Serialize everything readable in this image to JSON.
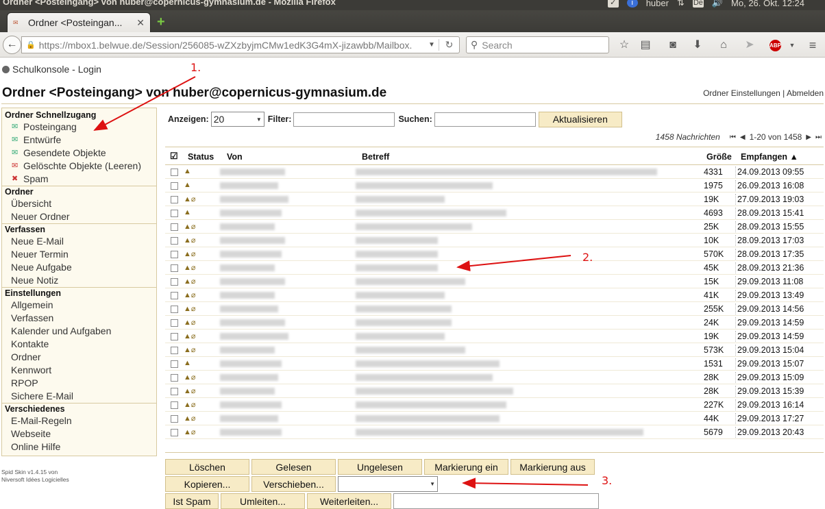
{
  "os_panel": {
    "window_title": "Ordner <Posteingang> von huber@copernicus-gymnasium.de - Mozilla Firefox",
    "user": "huber",
    "datetime": "Mo, 26. Okt. 12:24",
    "keyboard": "De"
  },
  "browser": {
    "tab_title": "Ordner <Posteingan...",
    "url": "https://mbox1.belwue.de/Session/256085-wZXzbyjmCMw1edK3G4mX-jizawbb/Mailbox.",
    "search_placeholder": "Search",
    "abp": "ABP"
  },
  "page": {
    "schulkonsole": "Schulkonsole - Login",
    "title": "Ordner <Posteingang> von huber@copernicus-gymnasium.de",
    "top_links": "Ordner Einstellungen | Abmelden",
    "skin_info_1": "Spid Skin v1.4.15 von",
    "skin_info_2": "Niversoft Idées Logicielles"
  },
  "sidebar": {
    "sections": [
      {
        "heading": "Ordner Schnellzugang",
        "items": [
          "Posteingang",
          "Entwürfe",
          "Gesendete Objekte",
          "Gelöschte Objekte  (Leeren)",
          "Spam"
        ]
      },
      {
        "heading": "Ordner",
        "items": [
          "Übersicht",
          "Neuer Ordner"
        ]
      },
      {
        "heading": "Verfassen",
        "items": [
          "Neue E-Mail",
          "Neuer Termin",
          "Neue Aufgabe",
          "Neue Notiz"
        ]
      },
      {
        "heading": "Einstellungen",
        "items": [
          "Allgemein",
          "Verfassen",
          "Kalender und Aufgaben",
          "Kontakte",
          "Ordner",
          "Kennwort",
          "RPOP",
          "Sichere E-Mail"
        ]
      },
      {
        "heading": "Verschiedenes",
        "items": [
          "E-Mail-Regeln",
          "Webseite",
          "Online Hilfe"
        ]
      }
    ]
  },
  "toolbar": {
    "show_label": "Anzeigen:",
    "show_value": "20",
    "filter_label": "Filter:",
    "search_label": "Suchen:",
    "refresh_button": "Aktualisieren"
  },
  "pager": {
    "count": "1458 Nachrichten",
    "range": "1-20 von 1458"
  },
  "table": {
    "headers": {
      "status": "Status",
      "from": "Von",
      "subject": "Betreff",
      "size": "Größe",
      "received": "Empfangen"
    },
    "rows": [
      {
        "attach": false,
        "size": "4331",
        "date": "24.09.2013 09:55"
      },
      {
        "attach": false,
        "size": "1975",
        "date": "26.09.2013 16:08"
      },
      {
        "attach": true,
        "size": "19K",
        "date": "27.09.2013 19:03"
      },
      {
        "attach": false,
        "size": "4693",
        "date": "28.09.2013 15:41"
      },
      {
        "attach": true,
        "size": "25K",
        "date": "28.09.2013 15:55"
      },
      {
        "attach": true,
        "size": "10K",
        "date": "28.09.2013 17:03"
      },
      {
        "attach": true,
        "size": "570K",
        "date": "28.09.2013 17:35"
      },
      {
        "attach": true,
        "size": "45K",
        "date": "28.09.2013 21:36"
      },
      {
        "attach": true,
        "size": "15K",
        "date": "29.09.2013 11:08"
      },
      {
        "attach": true,
        "size": "41K",
        "date": "29.09.2013 13:49"
      },
      {
        "attach": true,
        "size": "255K",
        "date": "29.09.2013 14:56"
      },
      {
        "attach": true,
        "size": "24K",
        "date": "29.09.2013 14:59"
      },
      {
        "attach": true,
        "size": "19K",
        "date": "29.09.2013 14:59"
      },
      {
        "attach": true,
        "size": "573K",
        "date": "29.09.2013 15:04"
      },
      {
        "attach": false,
        "size": "1531",
        "date": "29.09.2013 15:07"
      },
      {
        "attach": true,
        "size": "28K",
        "date": "29.09.2013 15:09"
      },
      {
        "attach": true,
        "size": "28K",
        "date": "29.09.2013 15:39"
      },
      {
        "attach": true,
        "size": "227K",
        "date": "29.09.2013 16:14"
      },
      {
        "attach": true,
        "size": "44K",
        "date": "29.09.2013 17:27"
      },
      {
        "attach": true,
        "size": "5679",
        "date": "29.09.2013 20:43"
      }
    ]
  },
  "actions": {
    "delete": "Löschen",
    "read": "Gelesen",
    "unread": "Ungelesen",
    "mark_on": "Markierung ein",
    "mark_off": "Markierung aus",
    "copy": "Kopieren...",
    "move": "Verschieben...",
    "is_spam": "Ist Spam",
    "redirect": "Umleiten...",
    "forward": "Weiterleiten..."
  },
  "annotations": [
    "1.",
    "2.",
    "3."
  ],
  "colors": {
    "annotation": "#dd1111",
    "button_bg": "#f7ebc6",
    "sidebar_bg": "#fdfaee",
    "border": "#d7c9a0"
  }
}
